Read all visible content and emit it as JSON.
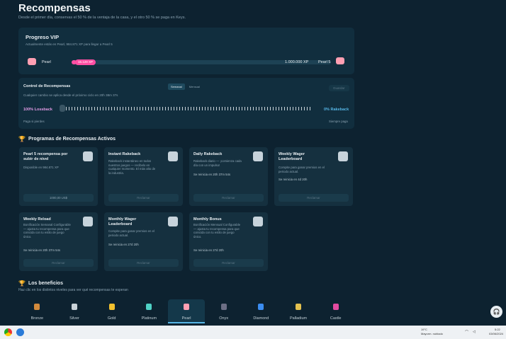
{
  "page": {
    "title": "Recompensas",
    "subtitle": "Desde el primer día, conservas el 50 % de la ventaja de la casa, y el otro 50 % se paga en Keys."
  },
  "vip": {
    "title": "Progreso VIP",
    "subtitle": "Actualmente estás en Pearl, 984.871 XP para llegar a Pearl 5",
    "current_tier": "Pearl",
    "current_xp": "15.129 XP",
    "target_xp": "1.000.000 XP",
    "next_tier": "Pearl 5",
    "progress": 0.015
  },
  "control": {
    "title": "Control de Recompensas",
    "subtitle": "Cualquier cambio se aplica desde el próximo ciclo en 20h 38m 37s",
    "tabs": [
      "Semanal",
      "Mensual"
    ],
    "active_tab": "Semanal",
    "save_label": "Guardar",
    "left_label": "100% Lossback",
    "right_label": "0% Rakeback",
    "left_hint": "Paga si pierdes",
    "right_hint": "Siempre paga"
  },
  "programs": {
    "heading": "Programas de Recompensas Activos",
    "cards": [
      {
        "title": "Pearl 5 recompensa por subir de nivel",
        "desc": "Disponible en 984.871 XP",
        "reset": "",
        "button": "1000,00 US$"
      },
      {
        "title": "Instant Rakeback",
        "desc": "Rakeback instantáneo en todos nuestros juegos — recíbelo en cualquier momento. El más alto de la industria.",
        "reset": "",
        "button": "Reclamar"
      },
      {
        "title": "Daily Rakeback",
        "desc": "Rakeback diario — ¡comienza cada día con un impulso!",
        "reset": "Se reinicia en 20h 37m 54s",
        "button": "Reclamar"
      },
      {
        "title": "Weekly Wager Leaderboard",
        "desc": "Compite para ganar premios en el periodo actual.",
        "reset": "Se reinicia en 4d 20h",
        "button": "Reclamar"
      },
      {
        "title": "Weekly Reload",
        "desc": "Bonificación Semanal Configurable — ajusta tu recompensa para que coincida con tu estilo de juego único.",
        "reset": "Se reinicia en 20h 37m 54s",
        "button": "Reclamar"
      },
      {
        "title": "Monthly Wager Leaderboard",
        "desc": "Compite para ganar premios en el periodo actual.",
        "reset": "Se reinicia en 27d 20h",
        "button": "Reclamar"
      },
      {
        "title": "Monthly Bonus",
        "desc": "Bonificación Mensual Configurable — ajusta tu recompensa para que coincida con tu estilo de juego único.",
        "reset": "Se reinicia en 27d 20h",
        "button": "Reclamar"
      }
    ]
  },
  "benefits": {
    "heading": "Los beneficios",
    "subtitle": "Haz clic en los distintos niveles para ver qué recompensas te esperan",
    "tiers": [
      {
        "name": "Bronze",
        "color": "#d28a3c"
      },
      {
        "name": "Silver",
        "color": "#c9d2d8"
      },
      {
        "name": "Gold",
        "color": "#f2c12e"
      },
      {
        "name": "Platinum",
        "color": "#4fd1c5"
      },
      {
        "name": "Pearl",
        "color": "#ff9fb2"
      },
      {
        "name": "Onyx",
        "color": "#6c6f85"
      },
      {
        "name": "Diamond",
        "color": "#3b8df0"
      },
      {
        "name": "Palladium",
        "color": "#e3c14f"
      },
      {
        "name": "Castle",
        "color": "#e24ba0"
      }
    ],
    "active_tier": "Pearl"
  },
  "taskbar": {
    "weather_temp": "19°C",
    "weather_desc": "Mayorm. nublado",
    "time": "5:22",
    "date": "03/06/2024"
  },
  "colors": {
    "accent": "#ff4fa3",
    "active_blue": "#56b6e6",
    "background": "#0d2230"
  },
  "icons": [
    "trophy-icon",
    "gem-icon",
    "support-icon",
    "chrome-icon",
    "app-icon",
    "wifi-icon",
    "volume-icon"
  ]
}
